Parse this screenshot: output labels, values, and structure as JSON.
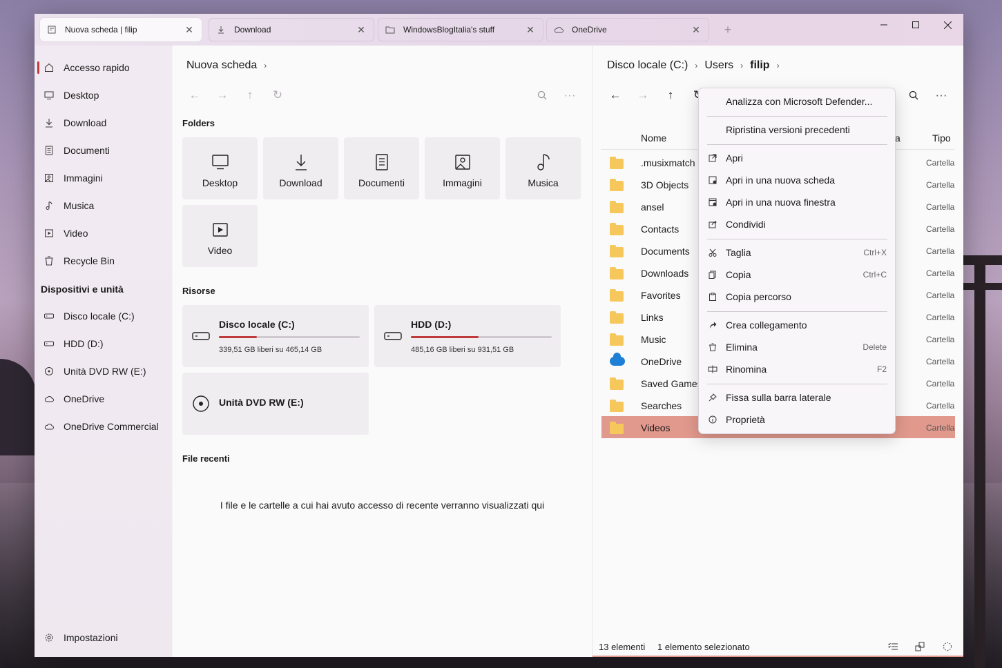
{
  "window": {
    "tabs": [
      {
        "label": "Nuova scheda | filip",
        "icon": "tab-page-icon",
        "active": true
      },
      {
        "label": "Download",
        "icon": "download-icon",
        "active": false
      },
      {
        "label": "WindowsBlogItalia's stuff",
        "icon": "folder-icon",
        "active": false
      },
      {
        "label": "OneDrive",
        "icon": "cloud-icon",
        "active": false
      }
    ],
    "new_tab_label": "+",
    "controls": {
      "minimize": "—",
      "maximize": "☐",
      "close": "✕"
    }
  },
  "sidebar": {
    "items": [
      {
        "label": "Accesso rapido",
        "icon": "home-icon",
        "selected": true
      },
      {
        "label": "Desktop",
        "icon": "monitor-icon"
      },
      {
        "label": "Download",
        "icon": "download-icon"
      },
      {
        "label": "Documenti",
        "icon": "document-icon"
      },
      {
        "label": "Immagini",
        "icon": "image-icon"
      },
      {
        "label": "Musica",
        "icon": "music-icon"
      },
      {
        "label": "Video",
        "icon": "video-icon"
      },
      {
        "label": "Recycle Bin",
        "icon": "recycle-bin-icon"
      }
    ],
    "devices_header": "Dispositivi e unità",
    "devices": [
      {
        "label": "Disco locale (C:)",
        "icon": "drive-icon"
      },
      {
        "label": "HDD (D:)",
        "icon": "drive-icon"
      },
      {
        "label": "Unità DVD RW (E:)",
        "icon": "disc-icon"
      },
      {
        "label": "OneDrive",
        "icon": "cloud-icon"
      },
      {
        "label": "OneDrive Commercial",
        "icon": "cloud-icon"
      }
    ],
    "settings_label": "Impostazioni"
  },
  "left_pane": {
    "breadcrumb": "Nuova scheda",
    "folders_header": "Folders",
    "folders": [
      {
        "label": "Desktop",
        "icon": "monitor-icon"
      },
      {
        "label": "Download",
        "icon": "download-icon"
      },
      {
        "label": "Documenti",
        "icon": "document-icon"
      },
      {
        "label": "Immagini",
        "icon": "image-icon"
      },
      {
        "label": "Musica",
        "icon": "music-icon"
      },
      {
        "label": "Video",
        "icon": "video-icon"
      }
    ],
    "resources_header": "Risorse",
    "drives": [
      {
        "name": "Disco locale (C:)",
        "free": "339,51 GB liberi su 465,14 GB",
        "used_fraction": 0.27
      },
      {
        "name": "HDD (D:)",
        "free": "485,16 GB liberi su 931,51 GB",
        "used_fraction": 0.48
      },
      {
        "name": "Unità DVD RW (E:)"
      }
    ],
    "recent_header": "File recenti",
    "recent_empty": "I file e le cartelle a cui hai avuto accesso di recente verranno visualizzati qui"
  },
  "right_pane": {
    "breadcrumb": [
      "Disco locale (C:)",
      "Users",
      "filip"
    ],
    "columns": {
      "name": "Nome",
      "hidden_partial": "a",
      "type": "Tipo"
    },
    "files": [
      {
        "name": ".musixmatch",
        "type": "Cartella"
      },
      {
        "name": "3D Objects",
        "type": "Cartella"
      },
      {
        "name": "ansel",
        "type": "Cartella"
      },
      {
        "name": "Contacts",
        "type": "Cartella"
      },
      {
        "name": "Documents",
        "type": "Cartella"
      },
      {
        "name": "Downloads",
        "type": "Cartella"
      },
      {
        "name": "Favorites",
        "type": "Cartella"
      },
      {
        "name": "Links",
        "type": "Cartella"
      },
      {
        "name": "Music",
        "type": "Cartella"
      },
      {
        "name": "OneDrive",
        "type": "Cartella",
        "cloud": true
      },
      {
        "name": "Saved Games",
        "type": "Cartella"
      },
      {
        "name": "Searches",
        "type": "Cartella"
      },
      {
        "name": "Videos",
        "type": "Cartella",
        "selected": true
      }
    ],
    "status": {
      "count": "13 elementi",
      "selection": "1 elemento selezionato"
    }
  },
  "context_menu": {
    "items": [
      {
        "label": "Analizza con Microsoft Defender...",
        "icon": ""
      },
      {
        "label": "Ripristina versioni precedenti",
        "icon": ""
      },
      {
        "label": "Apri",
        "icon": "open-external-icon"
      },
      {
        "label": "Apri in una nuova scheda",
        "icon": "new-tab-icon"
      },
      {
        "label": "Apri in una nuova finestra",
        "icon": "new-window-icon"
      },
      {
        "label": "Condividi",
        "icon": "share-icon"
      },
      {
        "label": "Taglia",
        "icon": "scissors-icon",
        "shortcut": "Ctrl+X"
      },
      {
        "label": "Copia",
        "icon": "copy-icon",
        "shortcut": "Ctrl+C"
      },
      {
        "label": "Copia percorso",
        "icon": "clipboard-icon"
      },
      {
        "label": "Crea collegamento",
        "icon": "shortcut-arrow-icon"
      },
      {
        "label": "Elimina",
        "icon": "trash-icon",
        "shortcut": "Delete"
      },
      {
        "label": "Rinomina",
        "icon": "rename-icon",
        "shortcut": "F2"
      },
      {
        "label": "Fissa sulla barra laterale",
        "icon": "pin-icon"
      },
      {
        "label": "Proprietà",
        "icon": "info-icon"
      }
    ]
  },
  "colors": {
    "accent": "#c0393b",
    "selection": "#e2998d",
    "folder": "#f6c85b",
    "onedrive": "#1e7fd6"
  }
}
